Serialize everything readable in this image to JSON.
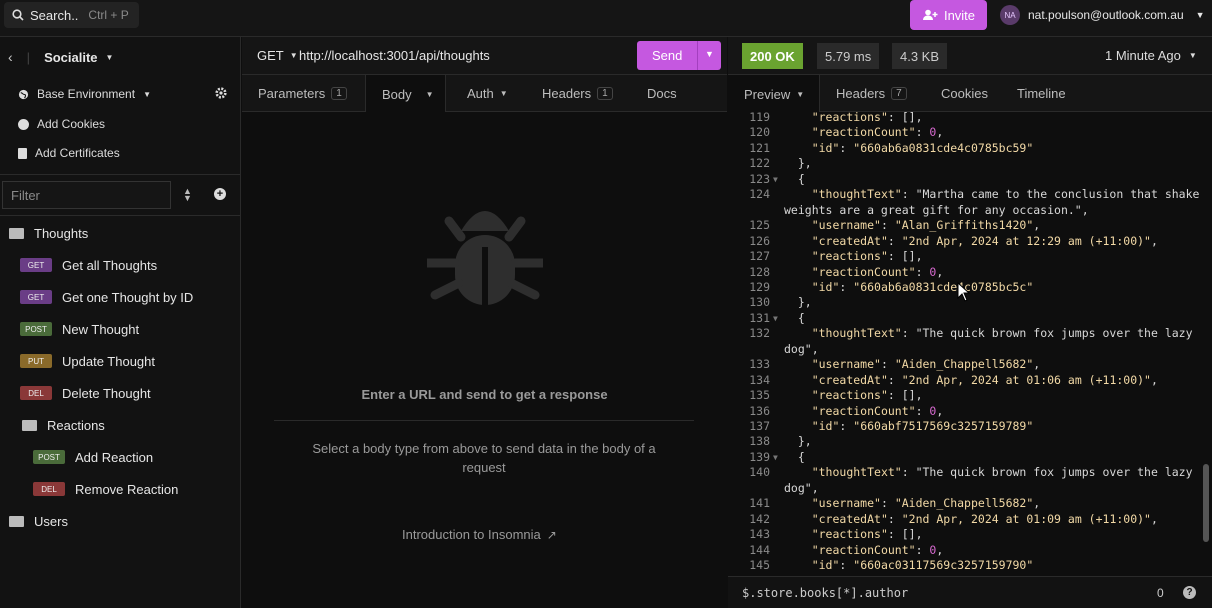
{
  "topbar": {
    "search_label": "Search..",
    "search_shortcut": "Ctrl + P",
    "invite_label": "Invite",
    "avatar_initials": "NA",
    "account_email": "nat.poulson@outlook.com.au"
  },
  "sidebar": {
    "project": "Socialite",
    "environment": "Base Environment",
    "add_cookies": "Add Cookies",
    "add_certificates": "Add Certificates",
    "filter_placeholder": "Filter",
    "tree": [
      {
        "label": "Thoughts",
        "type": "folder"
      },
      {
        "method": "GET",
        "label": "Get all Thoughts"
      },
      {
        "method": "GET",
        "label": "Get one Thought by ID"
      },
      {
        "method": "POST",
        "label": "New Thought"
      },
      {
        "method": "PUT",
        "label": "Update Thought"
      },
      {
        "method": "DEL",
        "label": "Delete Thought"
      },
      {
        "label": "Reactions",
        "type": "folder"
      },
      {
        "method": "POST",
        "label": "Add Reaction"
      },
      {
        "method": "DEL",
        "label": "Remove Reaction"
      },
      {
        "label": "Users",
        "type": "folder"
      }
    ]
  },
  "request": {
    "method": "GET",
    "url": "http://localhost:3001/api/thoughts",
    "send_label": "Send",
    "tabs": [
      {
        "label": "Parameters",
        "count": "1"
      },
      {
        "label": "Body"
      },
      {
        "label": "Auth"
      },
      {
        "label": "Headers",
        "count": "1"
      },
      {
        "label": "Docs"
      }
    ],
    "empty_title": "Enter a URL and send to get a response",
    "empty_hint": "Select a body type from above to send data in the body of a request",
    "intro_link": "Introduction to Insomnia"
  },
  "response": {
    "status": "200 OK",
    "time": "5.79 ms",
    "size": "4.3 KB",
    "age": "1 Minute Ago",
    "tabs": [
      {
        "label": "Preview"
      },
      {
        "label": "Headers",
        "count": "7"
      },
      {
        "label": "Cookies"
      },
      {
        "label": "Timeline"
      }
    ],
    "filter_query": "$.store.books[*].author",
    "filter_count": "0"
  },
  "code_lines": [
    {
      "n": "119",
      "t": "    \"reactions\": [],"
    },
    {
      "n": "120",
      "t": "    \"reactionCount\": 0,"
    },
    {
      "n": "121",
      "t": "    \"id\": \"660ab6a0831cde4c0785bc59\""
    },
    {
      "n": "122",
      "t": "  },"
    },
    {
      "n": "123",
      "t": "  {",
      "fold": true
    },
    {
      "n": "124",
      "t": "    \"thoughtText\": \"Martha came to the conclusion that shake"
    },
    {
      "n": "",
      "t": "weights are a great gift for any occasion.\","
    },
    {
      "n": "125",
      "t": "    \"username\": \"Alan_Griffiths1420\","
    },
    {
      "n": "126",
      "t": "    \"createdAt\": \"2nd Apr, 2024 at 12:29 am (+11:00)\","
    },
    {
      "n": "127",
      "t": "    \"reactions\": [],"
    },
    {
      "n": "128",
      "t": "    \"reactionCount\": 0,"
    },
    {
      "n": "129",
      "t": "    \"id\": \"660ab6a0831cde4c0785bc5c\""
    },
    {
      "n": "130",
      "t": "  },"
    },
    {
      "n": "131",
      "t": "  {",
      "fold": true
    },
    {
      "n": "132",
      "t": "    \"thoughtText\": \"The quick brown fox jumps over the lazy"
    },
    {
      "n": "",
      "t": "dog\","
    },
    {
      "n": "133",
      "t": "    \"username\": \"Aiden_Chappell5682\","
    },
    {
      "n": "134",
      "t": "    \"createdAt\": \"2nd Apr, 2024 at 01:06 am (+11:00)\","
    },
    {
      "n": "135",
      "t": "    \"reactions\": [],"
    },
    {
      "n": "136",
      "t": "    \"reactionCount\": 0,"
    },
    {
      "n": "137",
      "t": "    \"id\": \"660abf7517569c3257159789\""
    },
    {
      "n": "138",
      "t": "  },"
    },
    {
      "n": "139",
      "t": "  {",
      "fold": true
    },
    {
      "n": "140",
      "t": "    \"thoughtText\": \"The quick brown fox jumps over the lazy"
    },
    {
      "n": "",
      "t": "dog\","
    },
    {
      "n": "141",
      "t": "    \"username\": \"Aiden_Chappell5682\","
    },
    {
      "n": "142",
      "t": "    \"createdAt\": \"2nd Apr, 2024 at 01:09 am (+11:00)\","
    },
    {
      "n": "143",
      "t": "    \"reactions\": [],"
    },
    {
      "n": "144",
      "t": "    \"reactionCount\": 0,"
    },
    {
      "n": "145",
      "t": "    \"id\": \"660ac03117569c3257159790\""
    }
  ]
}
